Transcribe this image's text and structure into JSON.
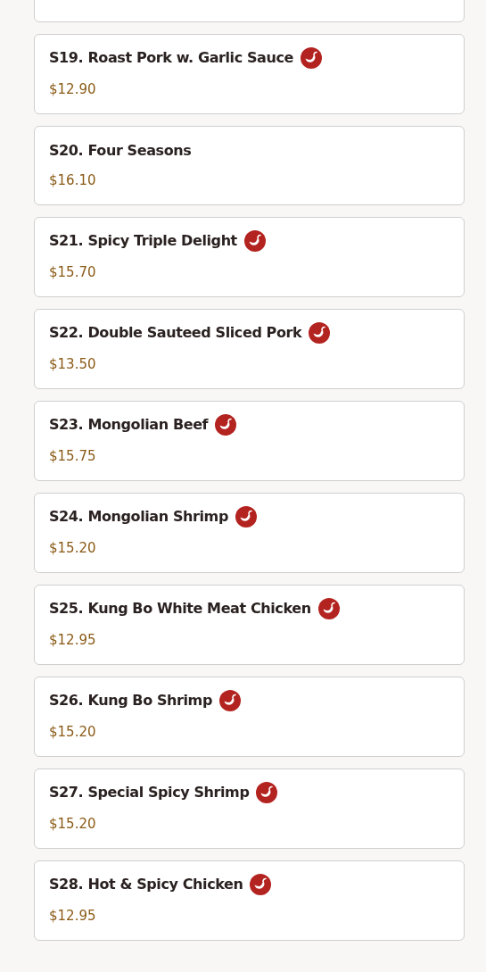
{
  "items": [
    {
      "name": "S19. Roast Pork w. Garlic Sauce",
      "price": "$12.90",
      "spicy": true
    },
    {
      "name": "S20. Four Seasons",
      "price": "$16.10",
      "spicy": false
    },
    {
      "name": "S21. Spicy Triple Delight",
      "price": "$15.70",
      "spicy": true
    },
    {
      "name": "S22. Double Sauteed Sliced Pork",
      "price": "$13.50",
      "spicy": true
    },
    {
      "name": "S23. Mongolian Beef",
      "price": "$15.75",
      "spicy": true
    },
    {
      "name": "S24. Mongolian Shrimp",
      "price": "$15.20",
      "spicy": true
    },
    {
      "name": "S25. Kung Bo White Meat Chicken",
      "price": "$12.95",
      "spicy": true
    },
    {
      "name": "S26. Kung Bo Shrimp",
      "price": "$15.20",
      "spicy": true
    },
    {
      "name": "S27. Special Spicy Shrimp",
      "price": "$15.20",
      "spicy": true
    },
    {
      "name": "S28. Hot & Spicy Chicken",
      "price": "$12.95",
      "spicy": true
    }
  ]
}
